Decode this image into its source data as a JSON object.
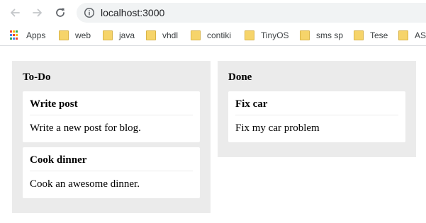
{
  "browser": {
    "url": "localhost:3000",
    "bookmarks": [
      {
        "label": "Apps",
        "icon": "apps-grid-icon"
      },
      {
        "label": "web",
        "icon": "folder-icon"
      },
      {
        "label": "java",
        "icon": "folder-icon"
      },
      {
        "label": "vhdl",
        "icon": "folder-icon"
      },
      {
        "label": "contiki",
        "icon": "folder-icon"
      },
      {
        "label": "TinyOS",
        "icon": "folder-icon"
      },
      {
        "label": "sms sp",
        "icon": "folder-icon"
      },
      {
        "label": "Tese",
        "icon": "folder-icon"
      },
      {
        "label": "ASI",
        "icon": "folder-icon"
      }
    ]
  },
  "board": {
    "columns": [
      {
        "title": "To-Do",
        "cards": [
          {
            "title": "Write post",
            "body": "Write a new post for blog."
          },
          {
            "title": "Cook dinner",
            "body": "Cook an awesome dinner."
          }
        ]
      },
      {
        "title": "Done",
        "cards": [
          {
            "title": "Fix car",
            "body": "Fix my car problem"
          }
        ]
      }
    ]
  },
  "colors": {
    "column_bg": "#ebebeb",
    "card_bg": "#ffffff",
    "omnibox_bg": "#f1f3f4",
    "folder": "#f6d46a"
  }
}
